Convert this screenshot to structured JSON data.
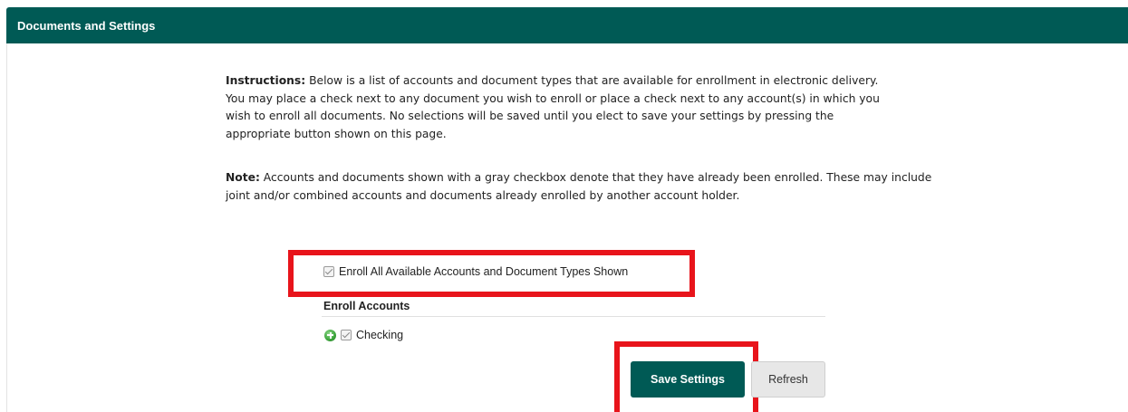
{
  "header": {
    "title": "Documents and Settings"
  },
  "instructions": {
    "label": "Instructions:",
    "text": " Below is a list of accounts and document types that are available for enrollment in electronic delivery. You may place a check next to any document you wish to enroll or place a check next to any account(s) in which you wish to enroll all documents. No selections will be saved until you elect to save your settings by pressing the appropriate button shown on this page."
  },
  "note": {
    "label": "Note:",
    "text": " Accounts and documents shown with a gray checkbox denote that they have already been enrolled. These may include joint and/or combined accounts and documents already enrolled by another account holder."
  },
  "enroll_all": {
    "label": "Enroll All Available Accounts and Document Types Shown",
    "checked": true
  },
  "accounts_section": {
    "title": "Enroll Accounts",
    "items": [
      {
        "label": "Checking",
        "checked": true,
        "icon": "plus-circle-icon"
      }
    ]
  },
  "buttons": {
    "save_label": "Save Settings",
    "refresh_label": "Refresh"
  },
  "colors": {
    "header_bg": "#005a55",
    "primary_button": "#005a55",
    "highlight": "#e8141b",
    "expand_icon": "#3aa33a"
  }
}
